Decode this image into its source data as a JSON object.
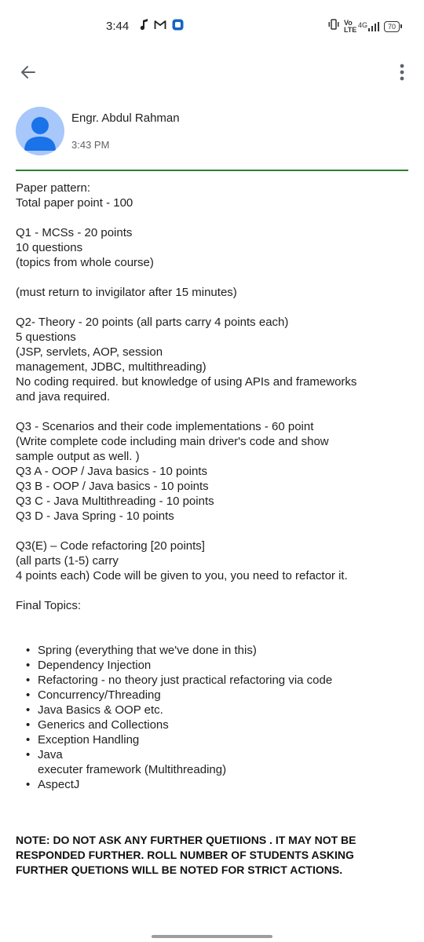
{
  "status_bar": {
    "time": "3:44",
    "left_icons": [
      "music-note-icon",
      "gmail-icon",
      "outlook-icon"
    ],
    "right_icons": [
      "vibrate-icon",
      "volte-icon",
      "signal-4g-icon"
    ],
    "volte_label": "Vo LTE",
    "network_label": "4G",
    "battery": "70"
  },
  "app_bar": {
    "back_icon": "arrow-back-icon",
    "more_icon": "more-vert-icon"
  },
  "message": {
    "sender": "Engr. Abdul Rahman",
    "time": "3:43 PM",
    "avatar_icon": "person-icon",
    "divider_color": "#2e7d32",
    "lines": {
      "l1": "Paper pattern:",
      "l2": "Total paper point - 100",
      "q1_1": "Q1 - MCSs - 20 points",
      "q1_2": "10 questions",
      "q1_3": "(topics from whole course)",
      "q1_note": "(must return to invigilator after 15 minutes)",
      "q2_1": "Q2- Theory - 20 points (all parts carry 4 points each)",
      "q2_2": "5 questions",
      "q2_3": "(JSP, servlets, AOP, session",
      "q2_4": "management, JDBC, multithreading)",
      "q2_5": "No coding required. but knowledge of using APIs and frameworks",
      "q2_6": "and java required.",
      "q3_1": "Q3 - Scenarios and their code implementations - 60 point",
      "q3_2": "(Write complete code including main driver's code and show",
      "q3_3": "sample output as well. )",
      "q3_4": "Q3 A - OOP / Java basics - 10 points",
      "q3_5": "Q3 B - OOP / Java basics  - 10 points",
      "q3_6": "Q3 C - Java Multithreading - 10 points",
      "q3_7": "Q3 D - Java Spring - 10 points",
      "q3e_1": "Q3(E) – Code refactoring [20 points]",
      "q3e_2": "(all parts (1-5) carry",
      "q3e_3": "4 points each)  Code will be given to you, you need to refactor it.",
      "final_topics": "Final Topics:"
    },
    "topics": [
      "Spring (everything that we've done in this)",
      "Dependency Injection",
      "Refactoring - no theory just practical refactoring via code",
      "Concurrency/Threading",
      "Java Basics & OOP etc.",
      "Generics and Collections",
      "Exception Handling",
      "Java",
      "AspectJ"
    ],
    "topic_java_cont": "executer framework  (Multithreading)",
    "note": "NOTE: DO NOT ASK ANY FURTHER QUETIIONS . IT MAY NOT BE RESPONDED FURTHER. ROLL NUMBER OF STUDENTS ASKING FURTHER QUETIONS WILL BE NOTED FOR STRICT ACTIONS."
  }
}
